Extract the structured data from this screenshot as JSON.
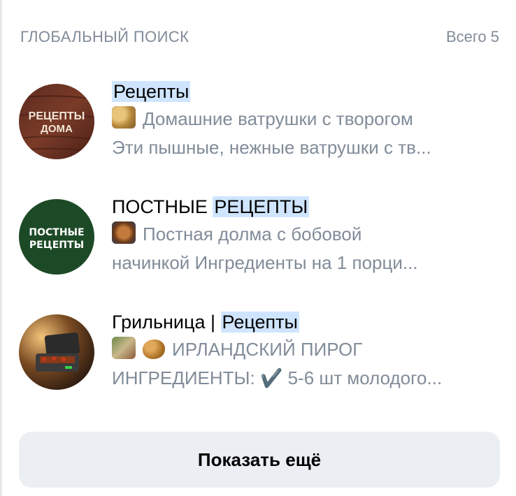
{
  "header": {
    "title": "ГЛОБАЛЬНЫЙ ПОИСК",
    "count": "Всего 5"
  },
  "results": [
    {
      "title_parts": [
        "",
        "Рецепты",
        ""
      ],
      "line1": "Домашние ватрушки с творогом",
      "line2": "Эти пышные, нежные ватрушки с тв...",
      "avatar_text": [
        "РЕЦЕПТЫ",
        "ДОМА"
      ],
      "emoji": [
        "pastry-emoji"
      ]
    },
    {
      "title_parts": [
        "ПОСТНЫЕ ",
        "РЕЦЕПТЫ",
        ""
      ],
      "line1": "Постная долма с бобовой",
      "line2": "начинкой  Ингредиенты на 1 порци...",
      "avatar_text": [
        "ПОСТНЫЕ",
        "РЕЦЕПТЫ"
      ],
      "emoji": [
        "food-emoji"
      ]
    },
    {
      "title_parts": [
        "Грильница | ",
        "Рецепты",
        ""
      ],
      "line1": "ИРЛАНДСКИЙ ПИРОГ",
      "line2": "ИНГРЕДИЕНТЫ:  ✔️  5-6 шт молодого...",
      "avatar_text": [],
      "emoji": [
        "video-thumb-emoji",
        "potato-emoji"
      ]
    }
  ],
  "show_more": "Показать ещё",
  "colors": {
    "highlight": "#cfe5ff",
    "secondary_text": "#818c99",
    "button_bg": "#ebeef2"
  }
}
